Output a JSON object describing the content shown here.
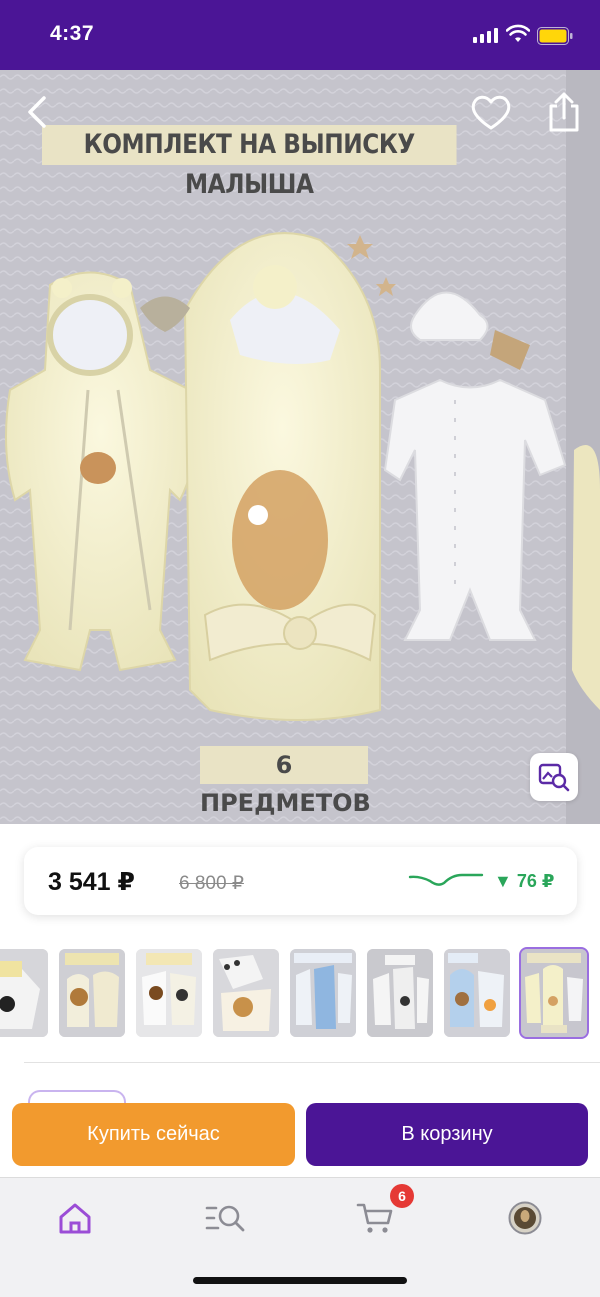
{
  "status_bar": {
    "time": "4:37"
  },
  "hero": {
    "title": "КОМПЛЕКТ НА ВЫПИСКУ МАЛЫША",
    "badge": "6 ПРЕДМЕТОВ"
  },
  "price": {
    "current": "3 541 ₽",
    "old": "6 800 ₽",
    "drop": "▼ 76 ₽",
    "accent_color": "#2aa65a"
  },
  "thumbnails": [
    {
      "name": "thumbnail-1",
      "selected": false
    },
    {
      "name": "thumbnail-2",
      "selected": false
    },
    {
      "name": "thumbnail-3",
      "selected": false
    },
    {
      "name": "thumbnail-4",
      "selected": false
    },
    {
      "name": "thumbnail-5",
      "selected": false
    },
    {
      "name": "thumbnail-6",
      "selected": false
    },
    {
      "name": "thumbnail-7",
      "selected": false
    },
    {
      "name": "thumbnail-8",
      "selected": true
    }
  ],
  "actions": {
    "buy_now": "Купить сейчас",
    "add_to_cart": "В корзину"
  },
  "tabbar": {
    "items": [
      {
        "name": "home",
        "icon": "home-icon",
        "active": true
      },
      {
        "name": "catalog",
        "icon": "search-list-icon",
        "active": false
      },
      {
        "name": "cart",
        "icon": "cart-icon",
        "active": false
      },
      {
        "name": "profile",
        "icon": "avatar",
        "active": false
      }
    ],
    "cart_count": "6"
  },
  "colors": {
    "brand": "#4b1596",
    "buy": "#f29a2e",
    "cart_badge": "#e53935"
  }
}
